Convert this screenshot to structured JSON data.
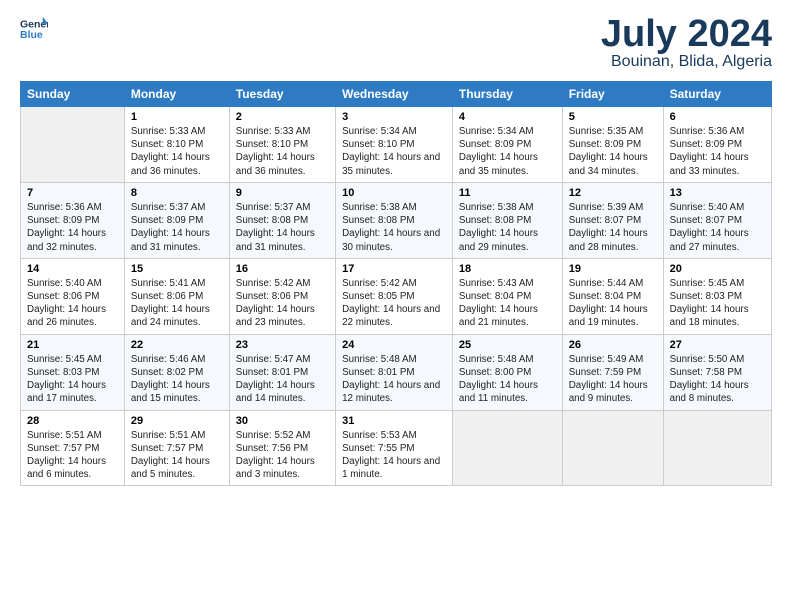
{
  "logo": {
    "line1": "General",
    "line2": "Blue"
  },
  "title": "July 2024",
  "subtitle": "Bouinan, Blida, Algeria",
  "days_of_week": [
    "Sunday",
    "Monday",
    "Tuesday",
    "Wednesday",
    "Thursday",
    "Friday",
    "Saturday"
  ],
  "weeks": [
    [
      {
        "day": "",
        "sunrise": "",
        "sunset": "",
        "daylight": ""
      },
      {
        "day": "1",
        "sunrise": "Sunrise: 5:33 AM",
        "sunset": "Sunset: 8:10 PM",
        "daylight": "Daylight: 14 hours and 36 minutes."
      },
      {
        "day": "2",
        "sunrise": "Sunrise: 5:33 AM",
        "sunset": "Sunset: 8:10 PM",
        "daylight": "Daylight: 14 hours and 36 minutes."
      },
      {
        "day": "3",
        "sunrise": "Sunrise: 5:34 AM",
        "sunset": "Sunset: 8:10 PM",
        "daylight": "Daylight: 14 hours and 35 minutes."
      },
      {
        "day": "4",
        "sunrise": "Sunrise: 5:34 AM",
        "sunset": "Sunset: 8:09 PM",
        "daylight": "Daylight: 14 hours and 35 minutes."
      },
      {
        "day": "5",
        "sunrise": "Sunrise: 5:35 AM",
        "sunset": "Sunset: 8:09 PM",
        "daylight": "Daylight: 14 hours and 34 minutes."
      },
      {
        "day": "6",
        "sunrise": "Sunrise: 5:36 AM",
        "sunset": "Sunset: 8:09 PM",
        "daylight": "Daylight: 14 hours and 33 minutes."
      }
    ],
    [
      {
        "day": "7",
        "sunrise": "Sunrise: 5:36 AM",
        "sunset": "Sunset: 8:09 PM",
        "daylight": "Daylight: 14 hours and 32 minutes."
      },
      {
        "day": "8",
        "sunrise": "Sunrise: 5:37 AM",
        "sunset": "Sunset: 8:09 PM",
        "daylight": "Daylight: 14 hours and 31 minutes."
      },
      {
        "day": "9",
        "sunrise": "Sunrise: 5:37 AM",
        "sunset": "Sunset: 8:08 PM",
        "daylight": "Daylight: 14 hours and 31 minutes."
      },
      {
        "day": "10",
        "sunrise": "Sunrise: 5:38 AM",
        "sunset": "Sunset: 8:08 PM",
        "daylight": "Daylight: 14 hours and 30 minutes."
      },
      {
        "day": "11",
        "sunrise": "Sunrise: 5:38 AM",
        "sunset": "Sunset: 8:08 PM",
        "daylight": "Daylight: 14 hours and 29 minutes."
      },
      {
        "day": "12",
        "sunrise": "Sunrise: 5:39 AM",
        "sunset": "Sunset: 8:07 PM",
        "daylight": "Daylight: 14 hours and 28 minutes."
      },
      {
        "day": "13",
        "sunrise": "Sunrise: 5:40 AM",
        "sunset": "Sunset: 8:07 PM",
        "daylight": "Daylight: 14 hours and 27 minutes."
      }
    ],
    [
      {
        "day": "14",
        "sunrise": "Sunrise: 5:40 AM",
        "sunset": "Sunset: 8:06 PM",
        "daylight": "Daylight: 14 hours and 26 minutes."
      },
      {
        "day": "15",
        "sunrise": "Sunrise: 5:41 AM",
        "sunset": "Sunset: 8:06 PM",
        "daylight": "Daylight: 14 hours and 24 minutes."
      },
      {
        "day": "16",
        "sunrise": "Sunrise: 5:42 AM",
        "sunset": "Sunset: 8:06 PM",
        "daylight": "Daylight: 14 hours and 23 minutes."
      },
      {
        "day": "17",
        "sunrise": "Sunrise: 5:42 AM",
        "sunset": "Sunset: 8:05 PM",
        "daylight": "Daylight: 14 hours and 22 minutes."
      },
      {
        "day": "18",
        "sunrise": "Sunrise: 5:43 AM",
        "sunset": "Sunset: 8:04 PM",
        "daylight": "Daylight: 14 hours and 21 minutes."
      },
      {
        "day": "19",
        "sunrise": "Sunrise: 5:44 AM",
        "sunset": "Sunset: 8:04 PM",
        "daylight": "Daylight: 14 hours and 19 minutes."
      },
      {
        "day": "20",
        "sunrise": "Sunrise: 5:45 AM",
        "sunset": "Sunset: 8:03 PM",
        "daylight": "Daylight: 14 hours and 18 minutes."
      }
    ],
    [
      {
        "day": "21",
        "sunrise": "Sunrise: 5:45 AM",
        "sunset": "Sunset: 8:03 PM",
        "daylight": "Daylight: 14 hours and 17 minutes."
      },
      {
        "day": "22",
        "sunrise": "Sunrise: 5:46 AM",
        "sunset": "Sunset: 8:02 PM",
        "daylight": "Daylight: 14 hours and 15 minutes."
      },
      {
        "day": "23",
        "sunrise": "Sunrise: 5:47 AM",
        "sunset": "Sunset: 8:01 PM",
        "daylight": "Daylight: 14 hours and 14 minutes."
      },
      {
        "day": "24",
        "sunrise": "Sunrise: 5:48 AM",
        "sunset": "Sunset: 8:01 PM",
        "daylight": "Daylight: 14 hours and 12 minutes."
      },
      {
        "day": "25",
        "sunrise": "Sunrise: 5:48 AM",
        "sunset": "Sunset: 8:00 PM",
        "daylight": "Daylight: 14 hours and 11 minutes."
      },
      {
        "day": "26",
        "sunrise": "Sunrise: 5:49 AM",
        "sunset": "Sunset: 7:59 PM",
        "daylight": "Daylight: 14 hours and 9 minutes."
      },
      {
        "day": "27",
        "sunrise": "Sunrise: 5:50 AM",
        "sunset": "Sunset: 7:58 PM",
        "daylight": "Daylight: 14 hours and 8 minutes."
      }
    ],
    [
      {
        "day": "28",
        "sunrise": "Sunrise: 5:51 AM",
        "sunset": "Sunset: 7:57 PM",
        "daylight": "Daylight: 14 hours and 6 minutes."
      },
      {
        "day": "29",
        "sunrise": "Sunrise: 5:51 AM",
        "sunset": "Sunset: 7:57 PM",
        "daylight": "Daylight: 14 hours and 5 minutes."
      },
      {
        "day": "30",
        "sunrise": "Sunrise: 5:52 AM",
        "sunset": "Sunset: 7:56 PM",
        "daylight": "Daylight: 14 hours and 3 minutes."
      },
      {
        "day": "31",
        "sunrise": "Sunrise: 5:53 AM",
        "sunset": "Sunset: 7:55 PM",
        "daylight": "Daylight: 14 hours and 1 minute."
      },
      {
        "day": "",
        "sunrise": "",
        "sunset": "",
        "daylight": ""
      },
      {
        "day": "",
        "sunrise": "",
        "sunset": "",
        "daylight": ""
      },
      {
        "day": "",
        "sunrise": "",
        "sunset": "",
        "daylight": ""
      }
    ]
  ]
}
